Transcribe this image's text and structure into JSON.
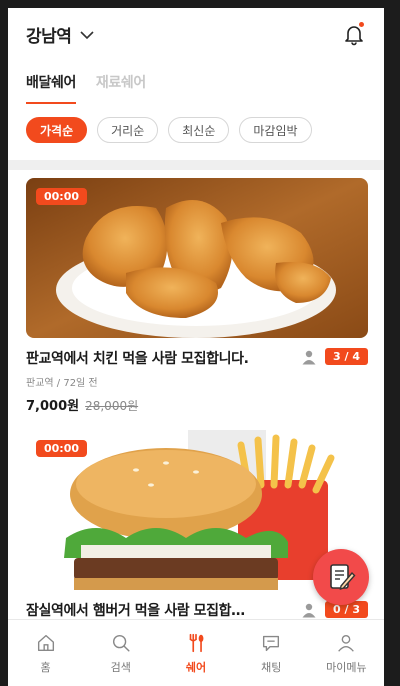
{
  "header": {
    "location": "강남역",
    "icons": {
      "location_dropdown": "chevron-down-icon",
      "notification": "bell-icon"
    }
  },
  "tabs": [
    {
      "label": "배달쉐어",
      "active": true
    },
    {
      "label": "재료쉐어",
      "active": false
    }
  ],
  "filters": [
    {
      "label": "가격순",
      "active": true
    },
    {
      "label": "거리순",
      "active": false
    },
    {
      "label": "최신순",
      "active": false
    },
    {
      "label": "마감임박",
      "active": false
    }
  ],
  "posts": [
    {
      "timer": "00:00",
      "title": "판교역에서 치킨 먹을 사람 모집합니다.",
      "meta": "판교역 / 72일 전",
      "price": "7,000원",
      "original_price": "28,000원",
      "members": "3 / 4",
      "image": "fried-chicken-image"
    },
    {
      "timer": "00:00",
      "title": "잠실역에서 햄버거 먹을 사람 모집합…",
      "members": "0 / 3",
      "image": "burger-and-fries-image"
    }
  ],
  "fab": {
    "icon": "write-post-icon"
  },
  "bottom_nav": [
    {
      "label": "홈",
      "icon": "home-icon",
      "active": false
    },
    {
      "label": "검색",
      "icon": "search-icon",
      "active": false
    },
    {
      "label": "쉐어",
      "icon": "fork-spoon-icon",
      "active": true
    },
    {
      "label": "채팅",
      "icon": "chat-icon",
      "active": false
    },
    {
      "label": "마이메뉴",
      "icon": "user-icon",
      "active": false
    }
  ],
  "colors": {
    "accent": "#f24a1d",
    "fab": "#f24a4a",
    "text": "#1a1a1a",
    "muted": "#888888"
  }
}
